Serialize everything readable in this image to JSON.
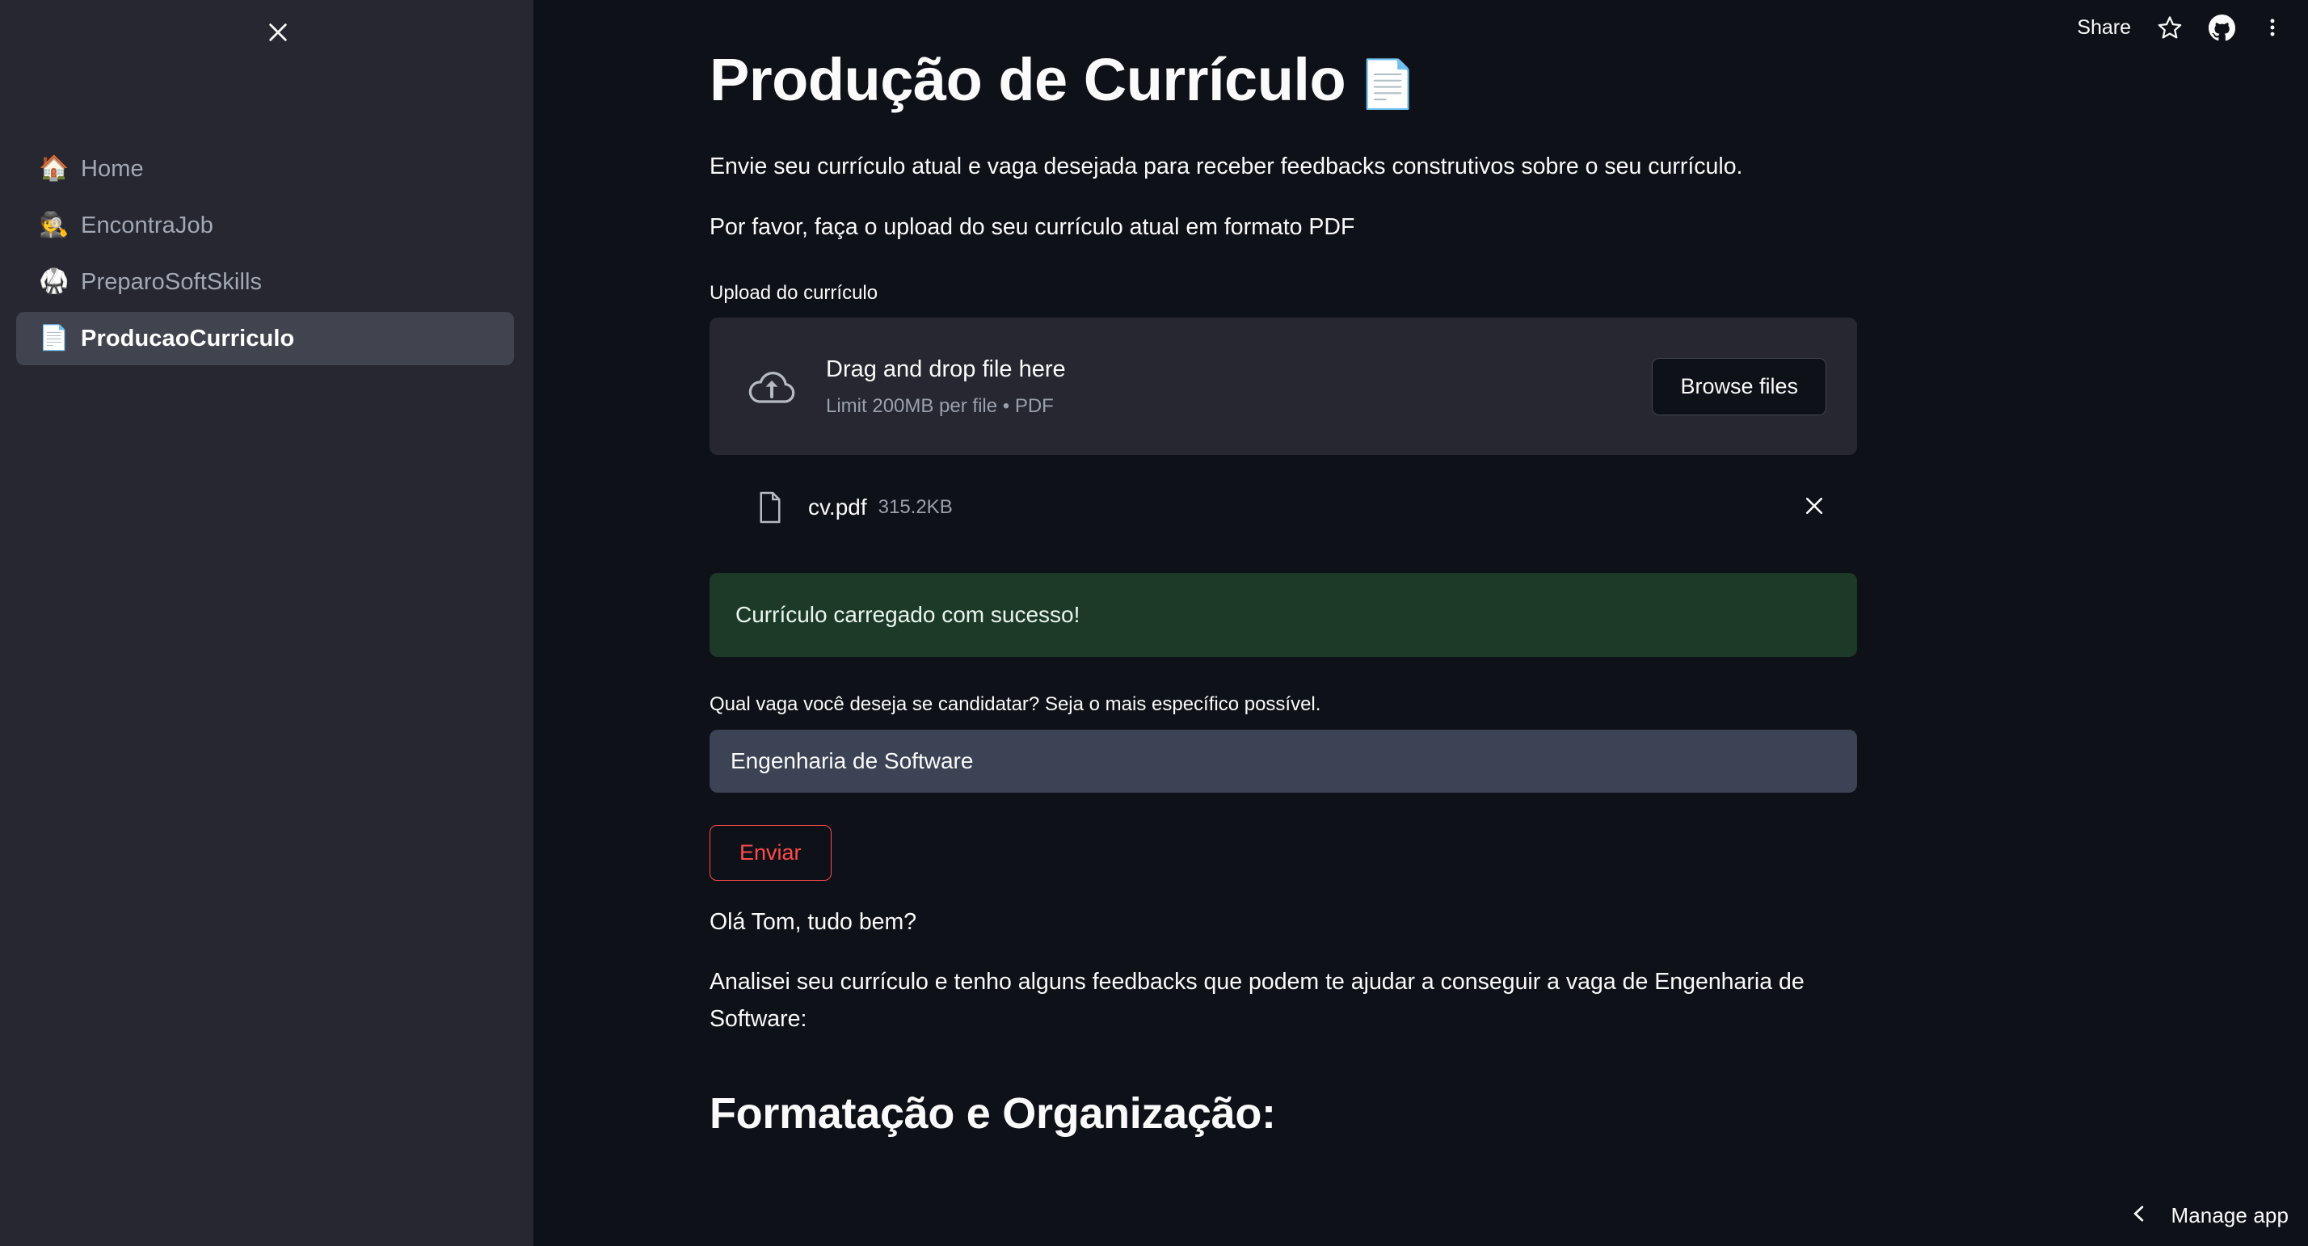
{
  "theme": {
    "main_bg": "#0e1117",
    "sidebar_bg": "#262730",
    "sidebar_active_bg": "#41444f",
    "text": "#fafafa",
    "muted_text": "#9aa0ad",
    "input_bg": "#3c4354",
    "success_bg": "#1d3a29",
    "accent_red": "#ff4b4b",
    "border": "#43464f"
  },
  "sidebar": {
    "close_icon": "close-icon",
    "items": [
      {
        "emoji": "🏠",
        "icon_name": "house-icon",
        "label": "Home",
        "active": false
      },
      {
        "emoji": "🕵",
        "icon_name": "detective-icon",
        "label": "EncontraJob",
        "active": false
      },
      {
        "emoji": "🥋",
        "icon_name": "martial-arts-uniform-icon",
        "label": "PreparoSoftSkills",
        "active": false
      },
      {
        "emoji": "📄",
        "icon_name": "page-facing-up-icon",
        "label": "ProducaoCurriculo",
        "active": true
      }
    ]
  },
  "toolbar": {
    "share_label": "Share",
    "star_icon": "star-icon",
    "github_icon": "github-icon",
    "menu_icon": "more-vertical-icon"
  },
  "main": {
    "title": "Produção de Currículo",
    "title_emoji": "📄",
    "intro_paragraph": "Envie seu currículo atual e vaga desejada para receber feedbacks construtivos sobre o seu currículo.",
    "instruction_paragraph": "Por favor, faça o upload do seu currículo atual em formato PDF",
    "uploader": {
      "label": "Upload do currículo",
      "cloud_icon": "cloud-upload-icon",
      "drag_text": "Drag and drop file here",
      "limit_text": "Limit 200MB per file • PDF",
      "browse_label": "Browse files"
    },
    "uploaded_file": {
      "file_icon": "file-icon",
      "name": "cv.pdf",
      "size": "315.2KB",
      "delete_icon": "close-icon"
    },
    "success_message": "Currículo carregado com sucesso!",
    "vaga_field": {
      "label": "Qual vaga você deseja se candidatar? Seja o mais específico possível.",
      "value": "Engenharia de Software",
      "placeholder": ""
    },
    "submit_label": "Enviar",
    "greeting_paragraph": "Olá Tom, tudo bem?",
    "analysis_paragraph": "Analisei seu currículo e tenho alguns feedbacks que podem te ajudar a conseguir a vaga de Engenharia de Software:",
    "section_heading": "Formatação e Organização:"
  },
  "footer": {
    "chevron_icon": "chevron-left-icon",
    "manage_app_label": "Manage app"
  }
}
